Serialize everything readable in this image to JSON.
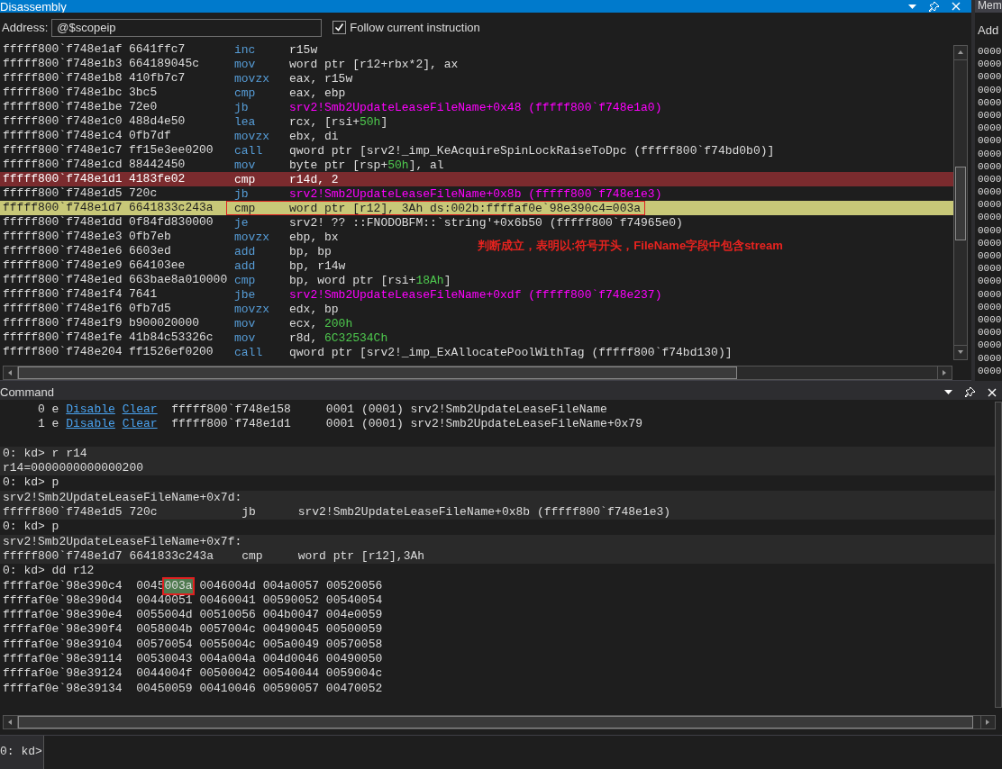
{
  "disassembly": {
    "title": "Disassembly",
    "address_label": "Address:",
    "address_value": "@$scopeip",
    "follow": {
      "label": "Follow current instruction",
      "checked": true
    },
    "rows": [
      {
        "address": "fffff800`f748e1af",
        "bytes": "6641ffc7",
        "mnemonic": "inc",
        "operand": [
          {
            "text": "r15w"
          }
        ],
        "breakpoint": false,
        "current": false,
        "annotated": false
      },
      {
        "address": "fffff800`f748e1b3",
        "bytes": "664189045c",
        "mnemonic": "mov",
        "operand": [
          {
            "text": "word ptr [r12+rbx*2], ax"
          }
        ],
        "breakpoint": false,
        "current": false,
        "annotated": false
      },
      {
        "address": "fffff800`f748e1b8",
        "bytes": "410fb7c7",
        "mnemonic": "movzx",
        "operand": [
          {
            "text": "eax, r15w"
          }
        ],
        "breakpoint": false,
        "current": false,
        "annotated": false
      },
      {
        "address": "fffff800`f748e1bc",
        "bytes": "3bc5",
        "mnemonic": "cmp",
        "operand": [
          {
            "text": "eax, ebp"
          }
        ],
        "breakpoint": false,
        "current": false,
        "annotated": false
      },
      {
        "address": "fffff800`f748e1be",
        "bytes": "72e0",
        "mnemonic": "jb",
        "operand": [
          {
            "text": "srv2!Smb2UpdateLeaseFileName+0x48 (fffff800`f748e1a0)",
            "kind": "symbol"
          }
        ],
        "breakpoint": false,
        "current": false,
        "annotated": false
      },
      {
        "address": "fffff800`f748e1c0",
        "bytes": "488d4e50",
        "mnemonic": "lea",
        "operand": [
          {
            "text": "rcx, [rsi+"
          },
          {
            "text": "50h",
            "kind": "number"
          },
          {
            "text": "]"
          }
        ],
        "breakpoint": false,
        "current": false,
        "annotated": false
      },
      {
        "address": "fffff800`f748e1c4",
        "bytes": "0fb7df",
        "mnemonic": "movzx",
        "operand": [
          {
            "text": "ebx, di"
          }
        ],
        "breakpoint": false,
        "current": false,
        "annotated": false
      },
      {
        "address": "fffff800`f748e1c7",
        "bytes": "ff15e3ee0200",
        "mnemonic": "call",
        "operand": [
          {
            "text": "qword ptr [srv2!_imp_KeAcquireSpinLockRaiseToDpc (fffff800`f74bd0b0)]"
          }
        ],
        "breakpoint": false,
        "current": false,
        "annotated": false
      },
      {
        "address": "fffff800`f748e1cd",
        "bytes": "88442450",
        "mnemonic": "mov",
        "operand": [
          {
            "text": "byte ptr [rsp+"
          },
          {
            "text": "50h",
            "kind": "number"
          },
          {
            "text": "], al"
          }
        ],
        "breakpoint": false,
        "current": false,
        "annotated": false
      },
      {
        "address": "fffff800`f748e1d1",
        "bytes": "4183fe02",
        "mnemonic": "cmp",
        "operand": [
          {
            "text": "r14d, 2"
          }
        ],
        "breakpoint": true,
        "current": false,
        "annotated": false
      },
      {
        "address": "fffff800`f748e1d5",
        "bytes": "720c",
        "mnemonic": "jb",
        "operand": [
          {
            "text": "srv2!Smb2UpdateLeaseFileName+0x8b (fffff800`f748e1e3)",
            "kind": "symbol"
          }
        ],
        "breakpoint": false,
        "current": false,
        "annotated": false
      },
      {
        "address": "fffff800`f748e1d7",
        "bytes": "6641833c243a",
        "mnemonic": "cmp",
        "operand": [
          {
            "text": "word ptr [r12], 3Ah ds:002b:ffffaf0e`98e390c4=003a"
          }
        ],
        "breakpoint": false,
        "current": true,
        "annotated": true
      },
      {
        "address": "fffff800`f748e1dd",
        "bytes": "0f84fd830000",
        "mnemonic": "je",
        "operand": [
          {
            "text": "srv2! ?? ::FNODOBFM::`string'+0x6b50 (fffff800`f74965e0)"
          }
        ],
        "breakpoint": false,
        "current": false,
        "annotated": false
      },
      {
        "address": "fffff800`f748e1e3",
        "bytes": "0fb7eb",
        "mnemonic": "movzx",
        "operand": [
          {
            "text": "ebp, bx"
          }
        ],
        "breakpoint": false,
        "current": false,
        "annotated": false
      },
      {
        "address": "fffff800`f748e1e6",
        "bytes": "6603ed",
        "mnemonic": "add",
        "operand": [
          {
            "text": "bp, bp"
          }
        ],
        "breakpoint": false,
        "current": false,
        "annotated": false
      },
      {
        "address": "fffff800`f748e1e9",
        "bytes": "664103ee",
        "mnemonic": "add",
        "operand": [
          {
            "text": "bp, r14w"
          }
        ],
        "breakpoint": false,
        "current": false,
        "annotated": false
      },
      {
        "address": "fffff800`f748e1ed",
        "bytes": "663bae8a010000",
        "mnemonic": "cmp",
        "operand": [
          {
            "text": "bp, word ptr [rsi+"
          },
          {
            "text": "18Ah",
            "kind": "number"
          },
          {
            "text": "]"
          }
        ],
        "breakpoint": false,
        "current": false,
        "annotated": false
      },
      {
        "address": "fffff800`f748e1f4",
        "bytes": "7641",
        "mnemonic": "jbe",
        "operand": [
          {
            "text": "srv2!Smb2UpdateLeaseFileName+0xdf (fffff800`f748e237)",
            "kind": "symbol"
          }
        ],
        "breakpoint": false,
        "current": false,
        "annotated": false
      },
      {
        "address": "fffff800`f748e1f6",
        "bytes": "0fb7d5",
        "mnemonic": "movzx",
        "operand": [
          {
            "text": "edx, bp"
          }
        ],
        "breakpoint": false,
        "current": false,
        "annotated": false
      },
      {
        "address": "fffff800`f748e1f9",
        "bytes": "b900020000",
        "mnemonic": "mov",
        "operand": [
          {
            "text": "ecx, "
          },
          {
            "text": "200h",
            "kind": "number"
          }
        ],
        "breakpoint": false,
        "current": false,
        "annotated": false
      },
      {
        "address": "fffff800`f748e1fe",
        "bytes": "41b84c53326c",
        "mnemonic": "mov",
        "operand": [
          {
            "text": "r8d, "
          },
          {
            "text": "6C32534Ch",
            "kind": "number"
          }
        ],
        "breakpoint": false,
        "current": false,
        "annotated": false
      },
      {
        "address": "fffff800`f748e204",
        "bytes": "ff1526ef0200",
        "mnemonic": "call",
        "operand": [
          {
            "text": "qword ptr [srv2!_imp_ExAllocatePoolWithTag (fffff800`f74bd130)]"
          }
        ],
        "breakpoint": false,
        "current": false,
        "annotated": false
      }
    ],
    "annotation": "判断成立，表明以:符号开头，FileName字段中包含stream"
  },
  "memory": {
    "title": "Mem",
    "address_label": "Add",
    "rows": [
      "0000",
      "0000",
      "0000",
      "0000",
      "0000",
      "0000",
      "0000",
      "0000",
      "0000",
      "0000",
      "0000",
      "0000",
      "0000",
      "0000",
      "0000",
      "0000",
      "0000",
      "0000",
      "0000",
      "0000",
      "0000",
      "0000",
      "0000",
      "0000",
      "0000",
      "0000"
    ]
  },
  "command": {
    "title": "Command",
    "prompt": "0: kd>",
    "lines": [
      {
        "kind": "segments",
        "shaded": false,
        "segments": [
          {
            "text": "     0 e "
          },
          {
            "text": "Disable",
            "kind": "link"
          },
          {
            "text": "Clear",
            "kind": "link"
          },
          {
            "text": "  fffff800`f748e158     0001 (0001) srv2!Smb2UpdateLeaseFileName"
          }
        ]
      },
      {
        "kind": "segments",
        "shaded": false,
        "segments": [
          {
            "text": "     1 e "
          },
          {
            "text": "Disable",
            "kind": "link"
          },
          {
            "text": "Clear",
            "kind": "link"
          },
          {
            "text": "  fffff800`f748e1d1     0001 (0001) srv2!Smb2UpdateLeaseFileName+0x79"
          }
        ]
      },
      {
        "kind": "blank",
        "shaded": false
      },
      {
        "kind": "text",
        "shaded": true,
        "text": "0: kd> r r14"
      },
      {
        "kind": "text",
        "shaded": true,
        "text": "r14=0000000000000200"
      },
      {
        "kind": "text",
        "shaded": false,
        "text": "0: kd> p"
      },
      {
        "kind": "text",
        "shaded": true,
        "text": "srv2!Smb2UpdateLeaseFileName+0x7d:"
      },
      {
        "kind": "text",
        "shaded": true,
        "text": "fffff800`f748e1d5 720c            jb      srv2!Smb2UpdateLeaseFileName+0x8b (fffff800`f748e1e3)"
      },
      {
        "kind": "text",
        "shaded": false,
        "text": "0: kd> p"
      },
      {
        "kind": "text",
        "shaded": true,
        "text": "srv2!Smb2UpdateLeaseFileName+0x7f:"
      },
      {
        "kind": "text",
        "shaded": true,
        "text": "fffff800`f748e1d7 6641833c243a    cmp     word ptr [r12],3Ah"
      },
      {
        "kind": "text",
        "shaded": false,
        "text": "0: kd> dd r12"
      },
      {
        "kind": "segments",
        "shaded": false,
        "segments": [
          {
            "text": "ffffaf0e`98e390c4  0045"
          },
          {
            "text": "003a",
            "kind": "marked"
          },
          {
            "text": " 0046004d 004a0057 00520056"
          }
        ]
      },
      {
        "kind": "text",
        "shaded": false,
        "text": "ffffaf0e`98e390d4  00440051 00460041 00590052 00540054"
      },
      {
        "kind": "text",
        "shaded": false,
        "text": "ffffaf0e`98e390e4  0055004d 00510056 004b0047 004e0059"
      },
      {
        "kind": "text",
        "shaded": false,
        "text": "ffffaf0e`98e390f4  0058004b 0057004c 00490045 00500059"
      },
      {
        "kind": "text",
        "shaded": false,
        "text": "ffffaf0e`98e39104  00570054 0055004c 005a0049 00570058"
      },
      {
        "kind": "text",
        "shaded": false,
        "text": "ffffaf0e`98e39114  00530043 004a004a 004d0046 00490050"
      },
      {
        "kind": "text",
        "shaded": false,
        "text": "ffffaf0e`98e39124  0044004f 00500042 00540044 0059004c"
      },
      {
        "kind": "text",
        "shaded": false,
        "text": "ffffaf0e`98e39134  00450059 00410046 00590057 00470052"
      }
    ]
  }
}
